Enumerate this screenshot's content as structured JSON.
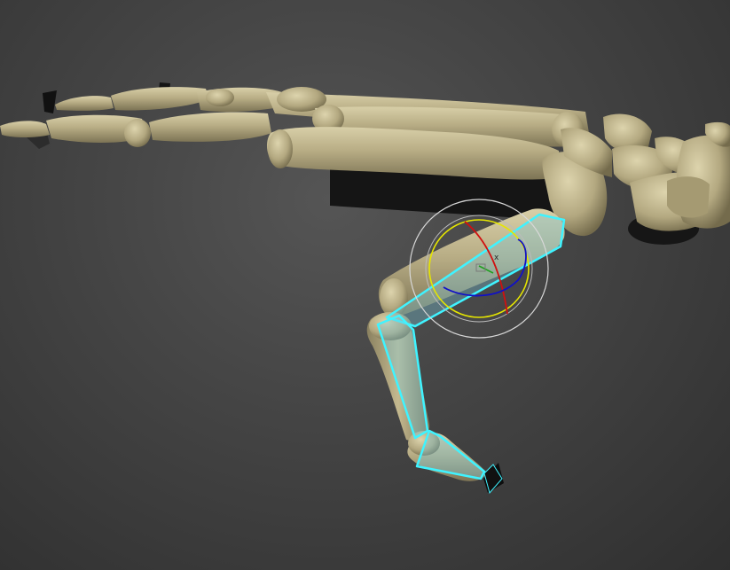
{
  "viewport": {
    "background_color": "#474747",
    "bone_color": "#b8ad85",
    "bone_highlight": "#d8cfa8",
    "bone_shadow": "#7d7455",
    "cast_shadow_color": "#141414",
    "selection_outline_color": "#3ff3ff",
    "bone_object_fill": "rgba(120,200,220,0.35)"
  },
  "gizmo": {
    "type": "rotate-gizmo",
    "outer_ring_color": "#d8d8d8",
    "screen_ring_color": "#e6e600",
    "x_axis_color": "#d01010",
    "y_axis_color": "#1010c8",
    "z_axis_color": "#20a020"
  }
}
